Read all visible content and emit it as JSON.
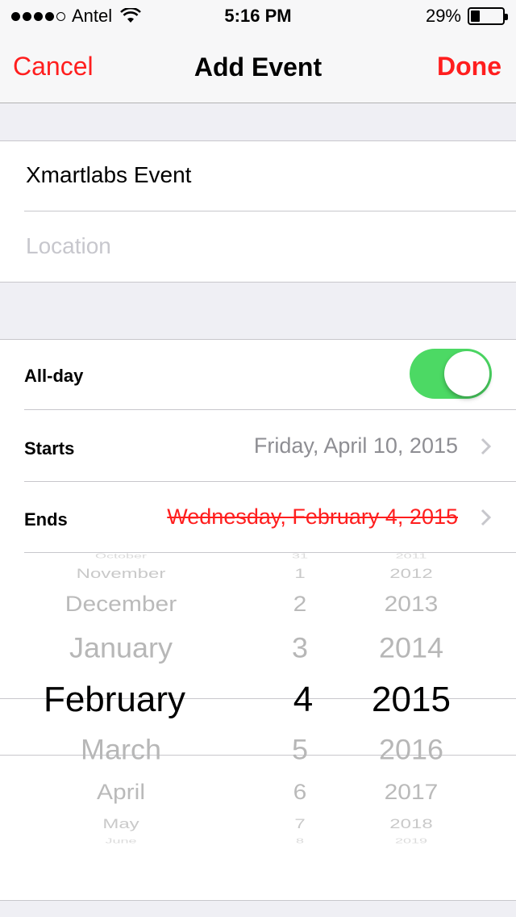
{
  "status_bar": {
    "carrier": "Antel",
    "time": "5:16 PM",
    "battery": "29%",
    "battery_level": 0.29,
    "signal_bars": 4
  },
  "nav": {
    "cancel": "Cancel",
    "title": "Add Event",
    "done": "Done"
  },
  "event": {
    "title": "Xmartlabs Event",
    "location_placeholder": "Location"
  },
  "rows": {
    "allday_label": "All-day",
    "allday_on": true,
    "starts_label": "Starts",
    "starts_value": "Friday, April 10, 2015",
    "ends_label": "Ends",
    "ends_value": "Wednesday, February 4, 2015"
  },
  "picker": {
    "months": [
      "October",
      "November",
      "December",
      "January",
      "February",
      "March",
      "April",
      "May",
      "June"
    ],
    "days": [
      "31",
      "1",
      "2",
      "3",
      "4",
      "5",
      "6",
      "7",
      "8"
    ],
    "years": [
      "2011",
      "2012",
      "2013",
      "2014",
      "2015",
      "2016",
      "2017",
      "2018",
      "2019"
    ],
    "selected_index": 4
  },
  "colors": {
    "accent": "#ff1e1e",
    "toggle_on": "#4cd964",
    "secondary_text": "#8e8e93"
  }
}
